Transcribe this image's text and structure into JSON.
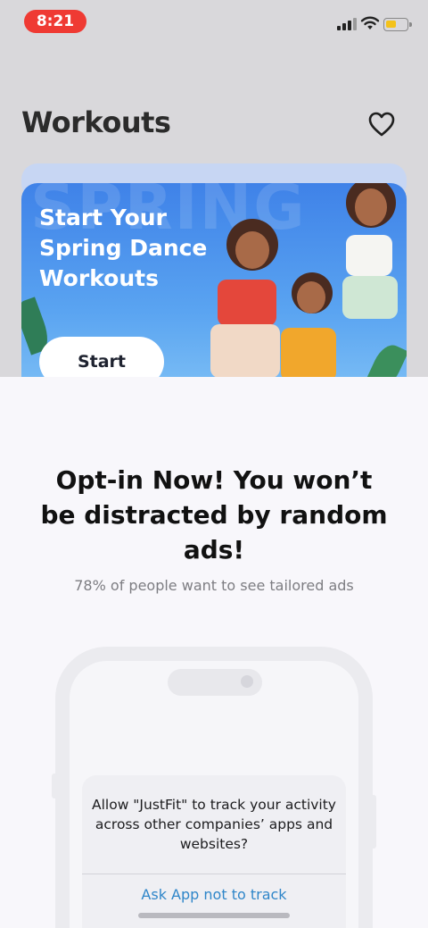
{
  "status_bar": {
    "time": "8:21"
  },
  "header": {
    "title": "Workouts",
    "favorite_icon": "heart-icon"
  },
  "banner": {
    "background_word": "SPRING",
    "title": "Start Your Spring Dance Workouts",
    "button_label": "Start"
  },
  "sheet": {
    "heading": "Opt-in Now! You won’t be distracted by random ads!",
    "subheading": "78% of people want to see tailored ads",
    "alert": {
      "message": "Allow \"JustFit\" to track your activity across other companies’ apps and websites?",
      "action": "Ask App not to track"
    }
  },
  "colors": {
    "time_pill": "#ef3a33",
    "banner": "#3f82e8",
    "link": "#2f86c9",
    "battery": "#f4c21a"
  }
}
